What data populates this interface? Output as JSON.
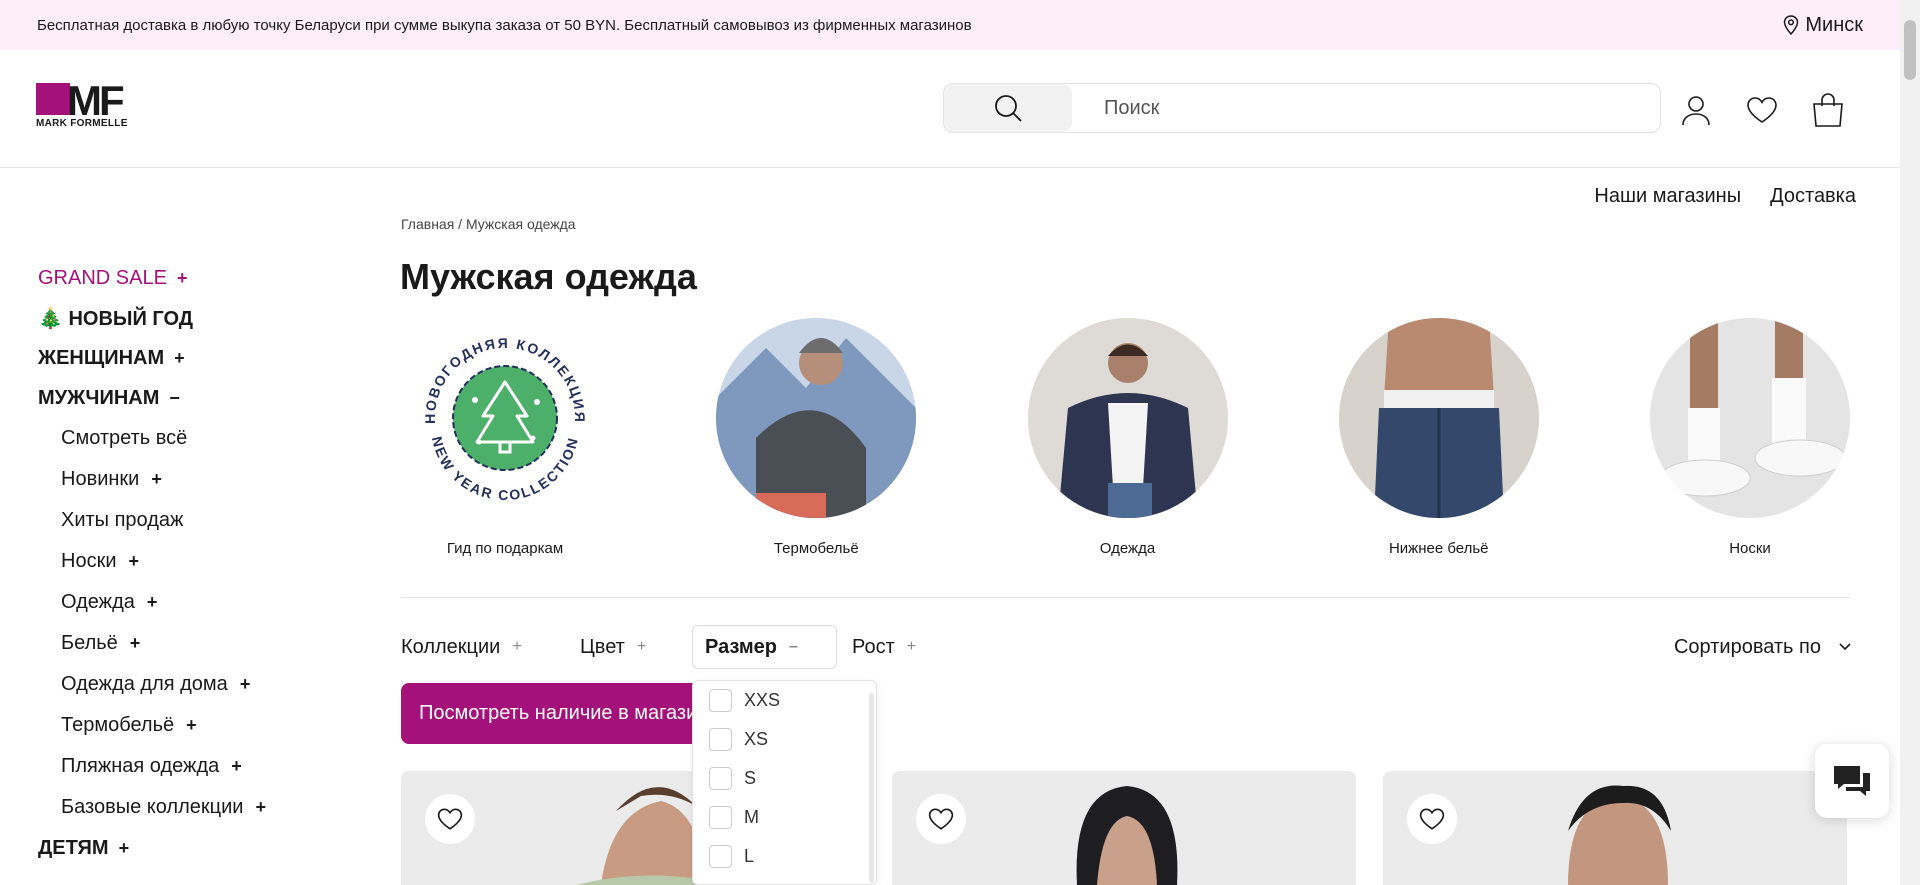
{
  "topbar": {
    "promo": "Бесплатная доставка в любую точку Беларуси при сумме выкупа заказа от 50 BYN. Бесплатный самовывоз из фирменных магазинов",
    "city": "Минск"
  },
  "logo": {
    "mark": "MF",
    "name": "MARK FORMELLE"
  },
  "search": {
    "placeholder": "Поиск"
  },
  "header_links": [
    "Наши магазины",
    "Доставка"
  ],
  "breadcrumb": "Главная / Мужская одежда",
  "page_title": "Мужская одежда",
  "sidebar": {
    "grand_sale": "GRAND SALE",
    "new_year": "🎄 НОВЫЙ ГОД",
    "women": "ЖЕНЩИНАМ",
    "men": "МУЖЧИНАМ",
    "men_items": [
      "Смотреть всё",
      "Новинки",
      "Хиты продаж",
      "Носки",
      "Одежда",
      "Бельё",
      "Одежда для дома",
      "Термобельё",
      "Пляжная одежда",
      "Базовые коллекции"
    ],
    "kids": "ДЕТЯМ"
  },
  "categories": [
    "Гид по подаркам",
    "Термобельё",
    "Одежда",
    "Нижнее бельё",
    "Носки"
  ],
  "gift_badge": {
    "top_text": "НОВОГОДНЯЯ КОЛЛЕКЦИЯ",
    "bottom_text": "NEW YEAR COLLECTION"
  },
  "filters": {
    "collections": "Коллекции",
    "color": "Цвет",
    "size": "Размер",
    "height": "Рост",
    "sort": "Сортировать по"
  },
  "stock_button": "Посмотреть наличие в магазинах",
  "size_options": [
    "XXS",
    "XS",
    "S",
    "M",
    "L"
  ],
  "colors": {
    "brand": "#a4117b",
    "topbar_bg": "#fdeefa",
    "badge_green": "#4caf6a"
  }
}
